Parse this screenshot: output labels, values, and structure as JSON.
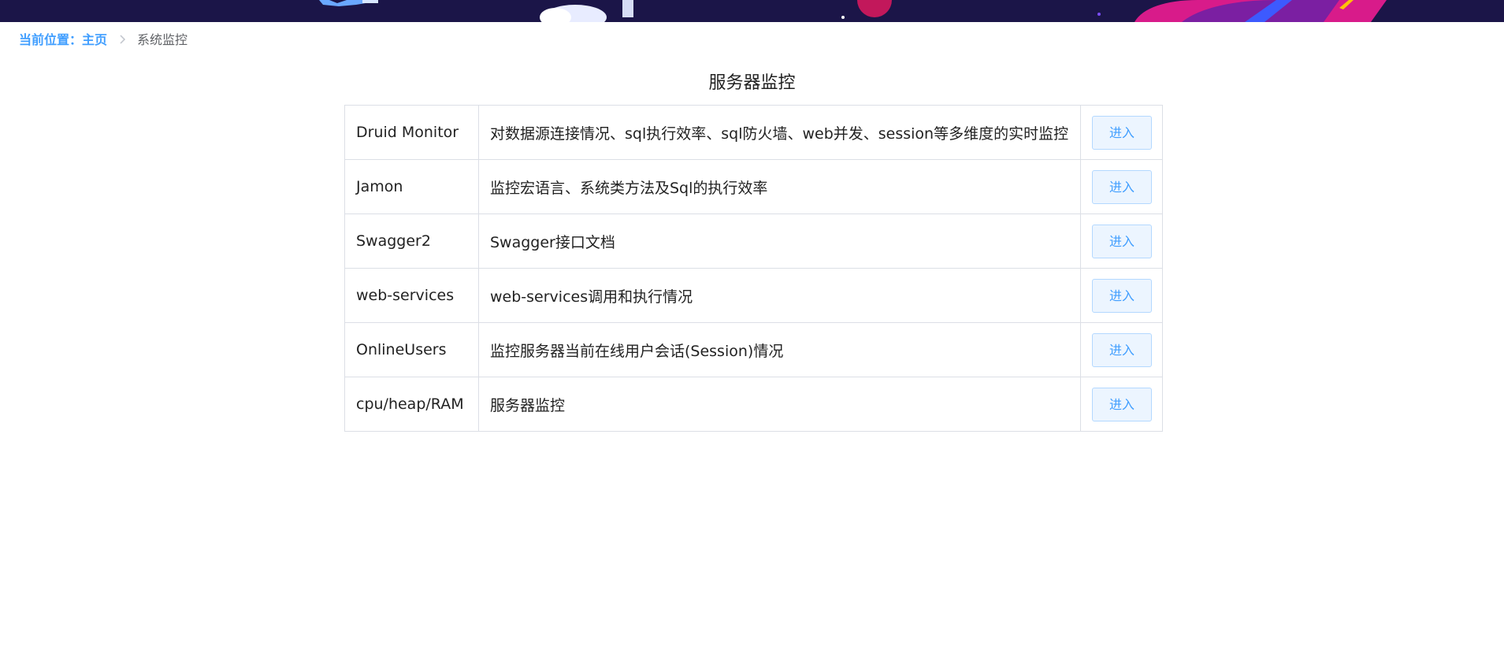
{
  "breadcrumb": {
    "prefix": "当前位置：",
    "home": "主页",
    "current": "系统监控"
  },
  "title": "服务器监控",
  "rows": [
    {
      "name": "Druid Monitor",
      "desc": "对数据源连接情况、sql执行效率、sql防火墙、web并发、session等多维度的实时监控",
      "action": "进入"
    },
    {
      "name": "Jamon",
      "desc": "监控宏语言、系统类方法及Sql的执行效率",
      "action": "进入"
    },
    {
      "name": "Swagger2",
      "desc": "Swagger接口文档",
      "action": "进入"
    },
    {
      "name": "web-services",
      "desc": "web-services调用和执行情况",
      "action": "进入"
    },
    {
      "name": "OnlineUsers",
      "desc": "监控服务器当前在线用户会话(Session)情况",
      "action": "进入"
    },
    {
      "name": "cpu/heap/RAM",
      "desc": "服务器监控",
      "action": "进入"
    }
  ],
  "colors": {
    "accent": "#409eff",
    "header_bg": "#1b1548",
    "button_bg": "#ecf5ff",
    "button_border": "#b3d8ff"
  }
}
